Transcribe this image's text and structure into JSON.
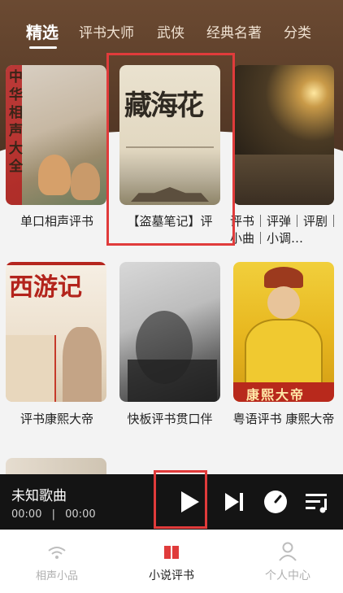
{
  "tabs": [
    {
      "label": "精选",
      "active": true
    },
    {
      "label": "评书大师"
    },
    {
      "label": "武侠"
    },
    {
      "label": "经典名著"
    },
    {
      "label": "分类"
    }
  ],
  "cards": [
    {
      "title": "单口相声评书",
      "cover_text": "中华相声大全"
    },
    {
      "title": "【盗墓笔记】评",
      "cover_text": "藏海花"
    },
    {
      "title": "评书｜评弹｜评剧｜小曲｜小调…",
      "cover_text": ""
    },
    {
      "title": "评书康熙大帝",
      "cover_text": "西游记"
    },
    {
      "title": "快板评书贯口伴",
      "cover_text": ""
    },
    {
      "title": "粤语评书 康熙大帝",
      "cover_text": "康熙大帝"
    }
  ],
  "player": {
    "song": "未知歌曲",
    "current_time": "00:00",
    "separator": "|",
    "total_time": "00:00",
    "icons": [
      "play-icon",
      "next-track-icon",
      "timer-icon",
      "playlist-icon"
    ]
  },
  "nav": [
    {
      "label": "相声小品",
      "icon": "wifi-icon",
      "active": false
    },
    {
      "label": "小说评书",
      "icon": "book-icon",
      "active": true
    },
    {
      "label": "个人中心",
      "icon": "user-icon",
      "active": false
    }
  ],
  "colors": {
    "accent": "#e03b3b",
    "header": "#5d3f2a",
    "player": "#141414"
  }
}
